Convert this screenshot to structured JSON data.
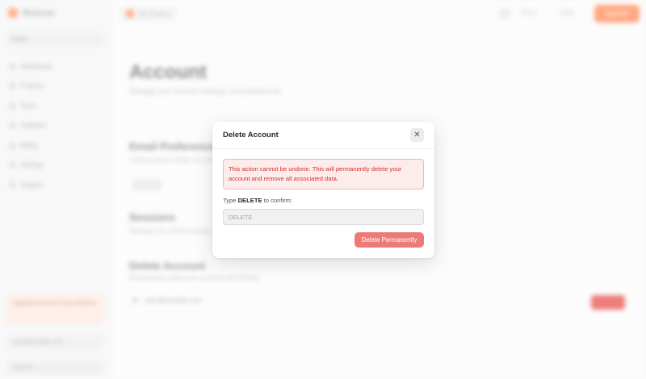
{
  "app": {
    "logo": "Relcon",
    "team": "Acme",
    "nav": [
      "Dashboard",
      "Projects",
      "Team",
      "Analytics",
      "Billing",
      "Settings",
      "Support"
    ],
    "upgrade": "Upgrade to Pro for more features",
    "user": "jane@example.com",
    "bottom": "Log out"
  },
  "topbar": {
    "project": "My Project",
    "link1": "Docs",
    "link2": "Help",
    "cta": "Upgrade"
  },
  "main": {
    "title": "Account",
    "subtitle": "Manage your account settings and preferences.",
    "section1_title": "Email Preferences",
    "section1_desc": "Choose which emails you receive.",
    "section2_title": "Sessions",
    "section2_desc": "Manage your active sessions.",
    "section3_title": "Delete Account",
    "section3_desc": "Permanently delete your account and all data.",
    "user_email": "user@example.com",
    "delete_bg_label": "Delete"
  },
  "modal": {
    "title": "Delete Account",
    "close_glyph": "✕",
    "warning": "This action cannot be undone. This will permanently delete your account and remove all associated data.",
    "confirm_prefix": "Type ",
    "confirm_keyword": "DELETE",
    "confirm_suffix": " to confirm:",
    "input_placeholder": "DELETE",
    "input_value": "",
    "delete_button": "Delete Permanently"
  },
  "colors": {
    "danger": "#d32f2f",
    "danger_bg": "#fdecec",
    "button": "#ec7b78",
    "accent": "#ff7a3d"
  }
}
